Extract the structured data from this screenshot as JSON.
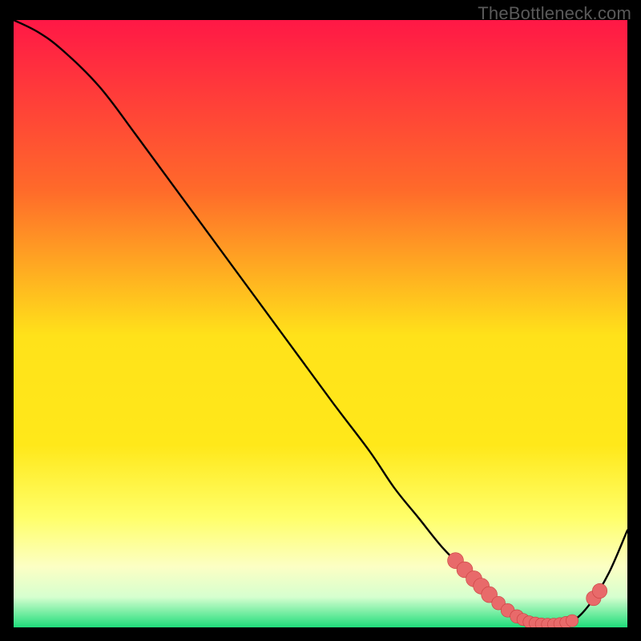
{
  "watermark": "TheBottleneck.com",
  "colors": {
    "background": "#000000",
    "gradient_top": "#ff1846",
    "gradient_mid_upper": "#ff7a2a",
    "gradient_mid": "#ffe21a",
    "gradient_mid_lower": "#ffff6a",
    "gradient_lower": "#f4ffd0",
    "gradient_bottom": "#1fdd7a",
    "curve": "#000000",
    "marker_fill": "#e86a6a",
    "marker_stroke": "#c93f3f"
  },
  "chart_data": {
    "type": "line",
    "title": "",
    "xlabel": "",
    "ylabel": "",
    "xlim": [
      0,
      100
    ],
    "ylim": [
      0,
      100
    ],
    "series": [
      {
        "name": "bottleneck-curve",
        "x": [
          0,
          4,
          8,
          14,
          20,
          28,
          36,
          44,
          52,
          58,
          62,
          66,
          70,
          74,
          78,
          82,
          85,
          88,
          91,
          94,
          97,
          100
        ],
        "y": [
          100,
          98,
          95,
          89,
          81,
          70,
          59,
          48,
          37,
          29,
          23,
          18,
          13,
          9,
          5,
          2,
          1,
          0.5,
          1,
          4,
          9,
          16
        ]
      }
    ],
    "markers": [
      {
        "x": 72.0,
        "y": 11.0,
        "r": 1.3
      },
      {
        "x": 73.5,
        "y": 9.5,
        "r": 1.3
      },
      {
        "x": 75.0,
        "y": 8.0,
        "r": 1.3
      },
      {
        "x": 76.2,
        "y": 6.8,
        "r": 1.3
      },
      {
        "x": 77.5,
        "y": 5.4,
        "r": 1.3
      },
      {
        "x": 79.0,
        "y": 4.0,
        "r": 1.1
      },
      {
        "x": 80.5,
        "y": 2.8,
        "r": 1.1
      },
      {
        "x": 82.0,
        "y": 1.8,
        "r": 1.1
      },
      {
        "x": 83.0,
        "y": 1.3,
        "r": 1.0
      },
      {
        "x": 84.0,
        "y": 0.9,
        "r": 1.0
      },
      {
        "x": 85.0,
        "y": 0.7,
        "r": 1.0
      },
      {
        "x": 86.0,
        "y": 0.55,
        "r": 1.0
      },
      {
        "x": 87.0,
        "y": 0.5,
        "r": 1.0
      },
      {
        "x": 88.0,
        "y": 0.5,
        "r": 1.0
      },
      {
        "x": 89.0,
        "y": 0.6,
        "r": 1.0
      },
      {
        "x": 90.0,
        "y": 0.8,
        "r": 1.0
      },
      {
        "x": 91.0,
        "y": 1.1,
        "r": 1.0
      },
      {
        "x": 94.5,
        "y": 4.8,
        "r": 1.2
      },
      {
        "x": 95.5,
        "y": 6.0,
        "r": 1.2
      }
    ]
  }
}
